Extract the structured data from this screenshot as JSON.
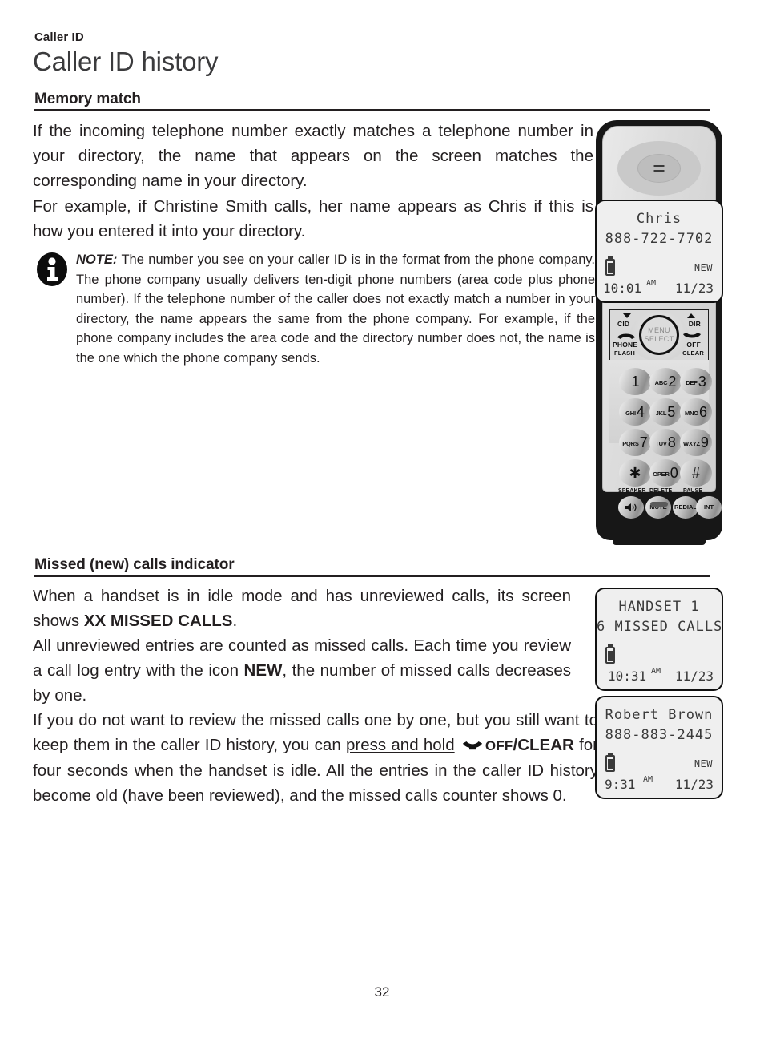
{
  "header": {
    "running_head": "Caller ID",
    "title": "Caller ID history"
  },
  "sections": [
    {
      "heading": "Memory match",
      "paragraphs": [
        "If the incoming telephone number exactly matches a telephone number in your directory, the name that appears on the screen matches the corresponding name in your directory.",
        "For example, if Christine Smith calls, her name appears as Chris if this is how you entered it into your directory."
      ],
      "note": {
        "label": "NOTE:",
        "icon": "info-icon",
        "text": "The number you see on your caller ID is in the format from the phone company. The phone company usually delivers ten-digit phone numbers (area code plus phone number). If the telephone number of the caller does not exactly match a number in your directory, the name appears the same from the phone company. For example, if the phone company includes the area code and the directory number does not, the name is the one which the phone company sends."
      }
    },
    {
      "heading": "Missed (new) calls indicator",
      "paragraphs": [
        {
          "parts": [
            {
              "text": "When a handset is in idle mode and has unreviewed calls, its screen shows ",
              "style": "normal"
            },
            {
              "text": "XX MISSED CALLS",
              "style": "bold"
            },
            {
              "text": ".",
              "style": "normal"
            }
          ]
        },
        {
          "parts": [
            {
              "text": "All unreviewed entries are counted as missed calls. Each time you review a call log entry with the icon ",
              "style": "normal"
            },
            {
              "text": "NEW",
              "style": "bold"
            },
            {
              "text": ", the number of missed calls decreases by one.",
              "style": "normal"
            }
          ]
        },
        {
          "parts": [
            {
              "text": "If you do not want to review the missed calls one by one, but you still want to keep them in the caller ID history, you can ",
              "style": "normal"
            },
            {
              "text": "press and hold",
              "style": "underline"
            },
            {
              "text": " ",
              "style": "normal"
            },
            {
              "text": "off-hook-phone-icon",
              "style": "icon"
            },
            {
              "text": "OFF",
              "style": "smallcaps"
            },
            {
              "text": "/CLEAR",
              "style": "bold"
            },
            {
              "text": " for four seconds when the handset is idle. All the entries in the caller ID history become old (have been reviewed), and the missed calls counter shows 0.",
              "style": "normal"
            }
          ]
        }
      ]
    }
  ],
  "handset": {
    "nav_keys": {
      "cid_label": "CID",
      "dir_label": "DIR",
      "menu_label": "MENU",
      "select_label": "SELECT",
      "phone_label": "PHONE",
      "flash_label": "FLASH",
      "off_label": "OFF",
      "clear_label": "CLEAR"
    },
    "keypad": [
      {
        "digit": "1",
        "letters": ""
      },
      {
        "digit": "2",
        "letters": "ABC"
      },
      {
        "digit": "3",
        "letters": "DEF"
      },
      {
        "digit": "4",
        "letters": "GHI"
      },
      {
        "digit": "5",
        "letters": "JKL"
      },
      {
        "digit": "6",
        "letters": "MNO"
      },
      {
        "digit": "7",
        "letters": "PQRS"
      },
      {
        "digit": "8",
        "letters": "TUV"
      },
      {
        "digit": "9",
        "letters": "WXYZ"
      },
      {
        "digit": "✱",
        "letters": ""
      },
      {
        "digit": "0",
        "letters": "OPER"
      },
      {
        "digit": "#",
        "letters": ""
      }
    ],
    "function_row": {
      "top_labels": [
        "SPEAKER",
        "DELETE",
        "PAUSE"
      ],
      "buttons": [
        "speaker-icon",
        "MUTE",
        "REDIAL",
        "INT"
      ]
    }
  },
  "lcd_screens": [
    {
      "id": "memory-match-screen",
      "line1": "Chris",
      "line2": "888-722-7702",
      "battery": "battery-icon",
      "new_badge": "NEW",
      "time": "10:01",
      "ampm": "AM",
      "date": "11/23"
    },
    {
      "id": "missed-calls-screen",
      "line1": "HANDSET 1",
      "line2": "6 MISSED CALLS",
      "battery": "battery-icon",
      "new_badge": "",
      "time": "10:31",
      "ampm": "AM",
      "date": "11/23"
    },
    {
      "id": "caller-entry-screen",
      "line1": "Robert Brown",
      "line2": "888-883-2445",
      "battery": "battery-icon",
      "new_badge": "NEW",
      "time": "9:31",
      "ampm": "AM",
      "date": "11/23"
    }
  ],
  "footer": {
    "page_number": "32"
  }
}
